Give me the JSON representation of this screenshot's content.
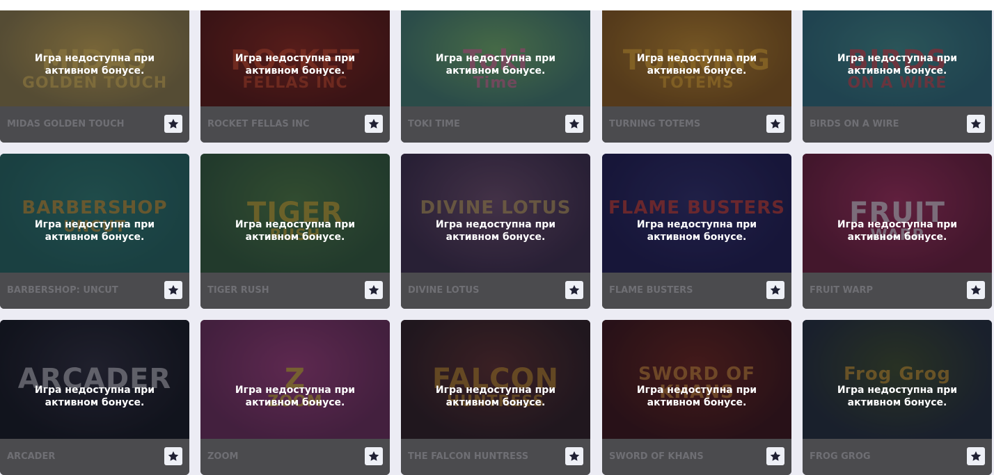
{
  "overlay_text": "Игра недоступна при активном бонусе.",
  "colors": {
    "card_footer": "#4b4b4e",
    "card_name_text": "#6f6f74",
    "star_button_bg": "#eef0f6",
    "star_color": "#1f2033",
    "page_bg": "#ececf4"
  },
  "rows": [
    {
      "games": [
        {
          "name": "MIDAS GOLDEN TOUCH",
          "art_text": "MIDAS",
          "art_sub": "GOLDEN TOUCH",
          "bg": "#8a7a48",
          "bg2": "#c9a850",
          "fg": "#e8c45a",
          "icon": "star-icon"
        },
        {
          "name": "ROCKET FELLAS INC",
          "art_text": "ROCKET",
          "art_sub": "FELLAS INC",
          "bg": "#5a1410",
          "bg2": "#8c2418",
          "fg": "#d84a2a",
          "icon": "star-icon"
        },
        {
          "name": "TOKI TIME",
          "art_text": "Toki",
          "art_sub": "Time",
          "bg": "#3e7a6e",
          "bg2": "#6fb06a",
          "fg": "#e86aa0",
          "icon": "star-icon"
        },
        {
          "name": "TURNING TOTEMS",
          "art_text": "TURNING",
          "art_sub": "TOTEMS",
          "bg": "#8a5a1a",
          "bg2": "#c28a2a",
          "fg": "#f0b030",
          "icon": "star-icon"
        },
        {
          "name": "BIRDS ON A WIRE",
          "art_text": "BIRDS",
          "art_sub": "ON A WIRE",
          "bg": "#2a6a7a",
          "bg2": "#3e8a8a",
          "fg": "#e0404a",
          "icon": "star-icon"
        }
      ]
    },
    {
      "games": [
        {
          "name": "BARBERSHOP: UNCUT",
          "art_text": "BARBERSHOP",
          "art_sub": "UNCUT",
          "bg": "#1f6460",
          "bg2": "#2a7a70",
          "fg": "#d89a30",
          "icon": "star-icon"
        },
        {
          "name": "TIGER RUSH",
          "art_text": "TIGER",
          "art_sub": "RUSH",
          "bg": "#2e5a3a",
          "bg2": "#4a7a40",
          "fg": "#d8b030",
          "icon": "star-icon"
        },
        {
          "name": "DIVINE LOTUS",
          "art_text": "DIVINE LOTUS",
          "art_sub": "",
          "bg": "#3a2a4a",
          "bg2": "#6a4a6a",
          "fg": "#c8a860",
          "icon": "star-icon"
        },
        {
          "name": "FLAME BUSTERS",
          "art_text": "FLAME BUSTERS",
          "art_sub": "",
          "bg": "#1a1850",
          "bg2": "#2a2a6a",
          "fg": "#e04030",
          "icon": "star-icon"
        },
        {
          "name": "FRUIT WARP",
          "art_text": "FRUIT",
          "art_sub": "WARP",
          "bg": "#6a1a3a",
          "bg2": "#a02a5a",
          "fg": "#e8e8f0",
          "icon": "star-icon"
        }
      ]
    },
    {
      "games": [
        {
          "name": "ARCADER",
          "art_text": "ARCADER",
          "art_sub": "",
          "bg": "#10141e",
          "bg2": "#2a2a3a",
          "fg": "#c8c8d0",
          "icon": "star-icon"
        },
        {
          "name": "ZOOM",
          "art_text": "Z",
          "art_sub": "ZOOM",
          "bg": "#6a2a5a",
          "bg2": "#9a3a7a",
          "fg": "#d8c030",
          "icon": "star-icon"
        },
        {
          "name": "THE FALCON HUNTRESS",
          "art_text": "FALCON",
          "art_sub": "HUNTRESS",
          "bg": "#2a1a20",
          "bg2": "#5a2a2a",
          "fg": "#c8902a",
          "icon": "star-icon"
        },
        {
          "name": "SWORD OF KHANS",
          "art_text": "SWORD OF KHANS",
          "art_sub": "",
          "bg": "#3a1014",
          "bg2": "#6a2018",
          "fg": "#d8903a",
          "icon": "star-icon"
        },
        {
          "name": "FROG GROG",
          "art_text": "Frog Grog",
          "art_sub": "",
          "bg": "#1e2a3a",
          "bg2": "#3a4a2a",
          "fg": "#d8a030",
          "icon": "star-icon"
        }
      ]
    }
  ]
}
